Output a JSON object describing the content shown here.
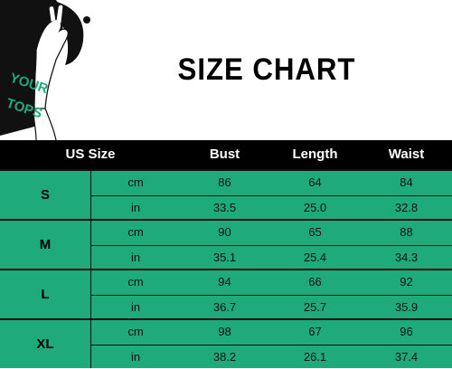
{
  "title": "SIZE CHART",
  "illustration": {
    "text_line1": "YOUR",
    "text_line2": "TOPS"
  },
  "table": {
    "headers": [
      "US Size",
      "Bust",
      "Length",
      "Waist"
    ],
    "rows": [
      {
        "size": "S",
        "cm": {
          "unit": "cm",
          "bust": "86",
          "length": "64",
          "waist": "84"
        },
        "in": {
          "unit": "in",
          "bust": "33.5",
          "length": "25.0",
          "waist": "32.8"
        }
      },
      {
        "size": "M",
        "cm": {
          "unit": "cm",
          "bust": "90",
          "length": "65",
          "waist": "88"
        },
        "in": {
          "unit": "in",
          "bust": "35.1",
          "length": "25.4",
          "waist": "34.3"
        }
      },
      {
        "size": "L",
        "cm": {
          "unit": "cm",
          "bust": "94",
          "length": "66",
          "waist": "92"
        },
        "in": {
          "unit": "in",
          "bust": "36.7",
          "length": "25.7",
          "waist": "35.9"
        }
      },
      {
        "size": "XL",
        "cm": {
          "unit": "cm",
          "bust": "98",
          "length": "67",
          "waist": "96"
        },
        "in": {
          "unit": "in",
          "bust": "38.2",
          "length": "26.1",
          "waist": "37.4"
        }
      }
    ]
  },
  "colors": {
    "table_fill": "#1faa7c",
    "header_fill": "#000000",
    "text": "#000000"
  }
}
